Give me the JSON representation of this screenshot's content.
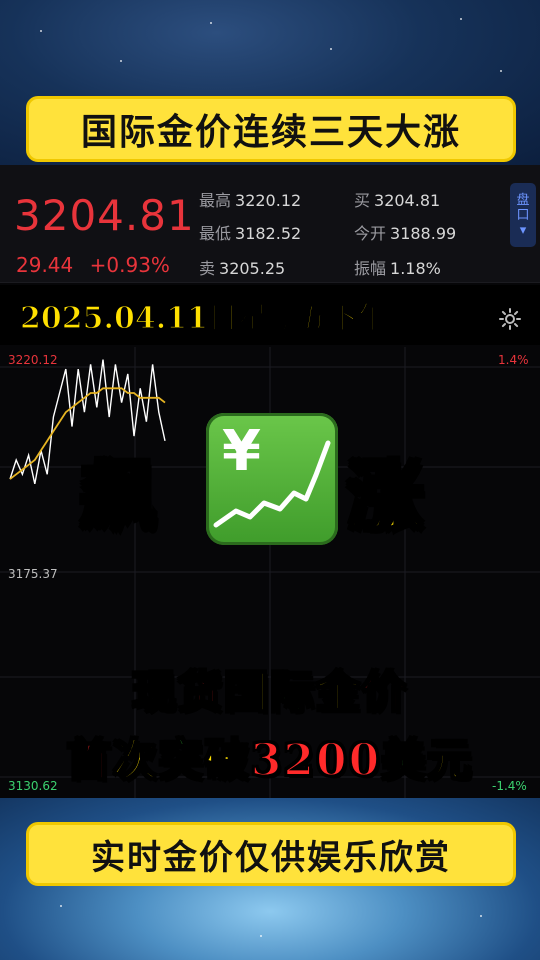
{
  "banner_top": "国际金价连续三天大涨",
  "banner_bottom": "实时金价仅供娱乐欣赏",
  "quote": {
    "price": "3204.81",
    "change": "29.44",
    "change_pct": "+0.93%",
    "high_label": "最高",
    "high_value": "3220.12",
    "low_label": "最低",
    "low_value": "3182.52",
    "ask_label": "卖",
    "ask_value": "3205.25",
    "bid_label": "买",
    "bid_value": "3204.81",
    "open_label": "今开",
    "open_value": "3188.99",
    "amp_label": "振幅",
    "amp_value": "1.18%",
    "side_button_line1": "盘",
    "side_button_line2": "口",
    "side_button_arrow": "▾",
    "up_color": "#e8343b"
  },
  "date_overlay": "2025.04.11日星期五下午",
  "settings_icon": "gear-icon",
  "chart_data": {
    "type": "line",
    "y_ticks_left": [
      "3220.12",
      "3175.37",
      "3130.62"
    ],
    "y_ticks_right": [
      "1.4%",
      "-1.4%"
    ],
    "ylim": [
      3130.62,
      3220.12
    ],
    "series": [
      {
        "values": [
          3195,
          3199,
          3196,
          3200,
          3194,
          3201,
          3196,
          3208,
          3213,
          3218,
          3206,
          3218,
          3209,
          3219,
          3210,
          3220,
          3208,
          3219,
          3211,
          3217,
          3204,
          3214,
          3207,
          3219,
          3209,
          3203
        ],
        "color": "#ffffff"
      },
      {
        "values": [
          3195,
          3196,
          3197,
          3198,
          3199,
          3201,
          3203,
          3205,
          3207,
          3209,
          3210,
          3211,
          3212,
          3213,
          3213,
          3214,
          3214,
          3214,
          3214,
          3213,
          3213,
          3212,
          3212,
          3212,
          3212,
          3211
        ],
        "color": "#e6b422"
      }
    ]
  },
  "overlay_word_left": "飙",
  "overlay_word_right": "涨",
  "emoji_icon": "chart-yen-icon",
  "emoji_glyph": "¥",
  "headline_line1": [
    {
      "text": "现",
      "color": "#ff2a2a"
    },
    {
      "text": "货",
      "color": "#ff2a2a"
    },
    {
      "text": "国",
      "color": "#ffe000"
    },
    {
      "text": "际",
      "color": "#3cdc3c"
    },
    {
      "text": "金",
      "color": "#ffe000"
    },
    {
      "text": "价",
      "color": "#ff2a2a"
    }
  ],
  "headline_line2": [
    {
      "text": "首",
      "color": "#ff2a2a"
    },
    {
      "text": "次",
      "color": "#ffe000"
    },
    {
      "text": "突",
      "color": "#3cdc3c"
    },
    {
      "text": "破",
      "color": "#ffe000"
    },
    {
      "text": "3200",
      "color": "#ff2a2a"
    },
    {
      "text": "美",
      "color": "#3cdc3c"
    },
    {
      "text": "元",
      "color": "#ffe000"
    }
  ]
}
